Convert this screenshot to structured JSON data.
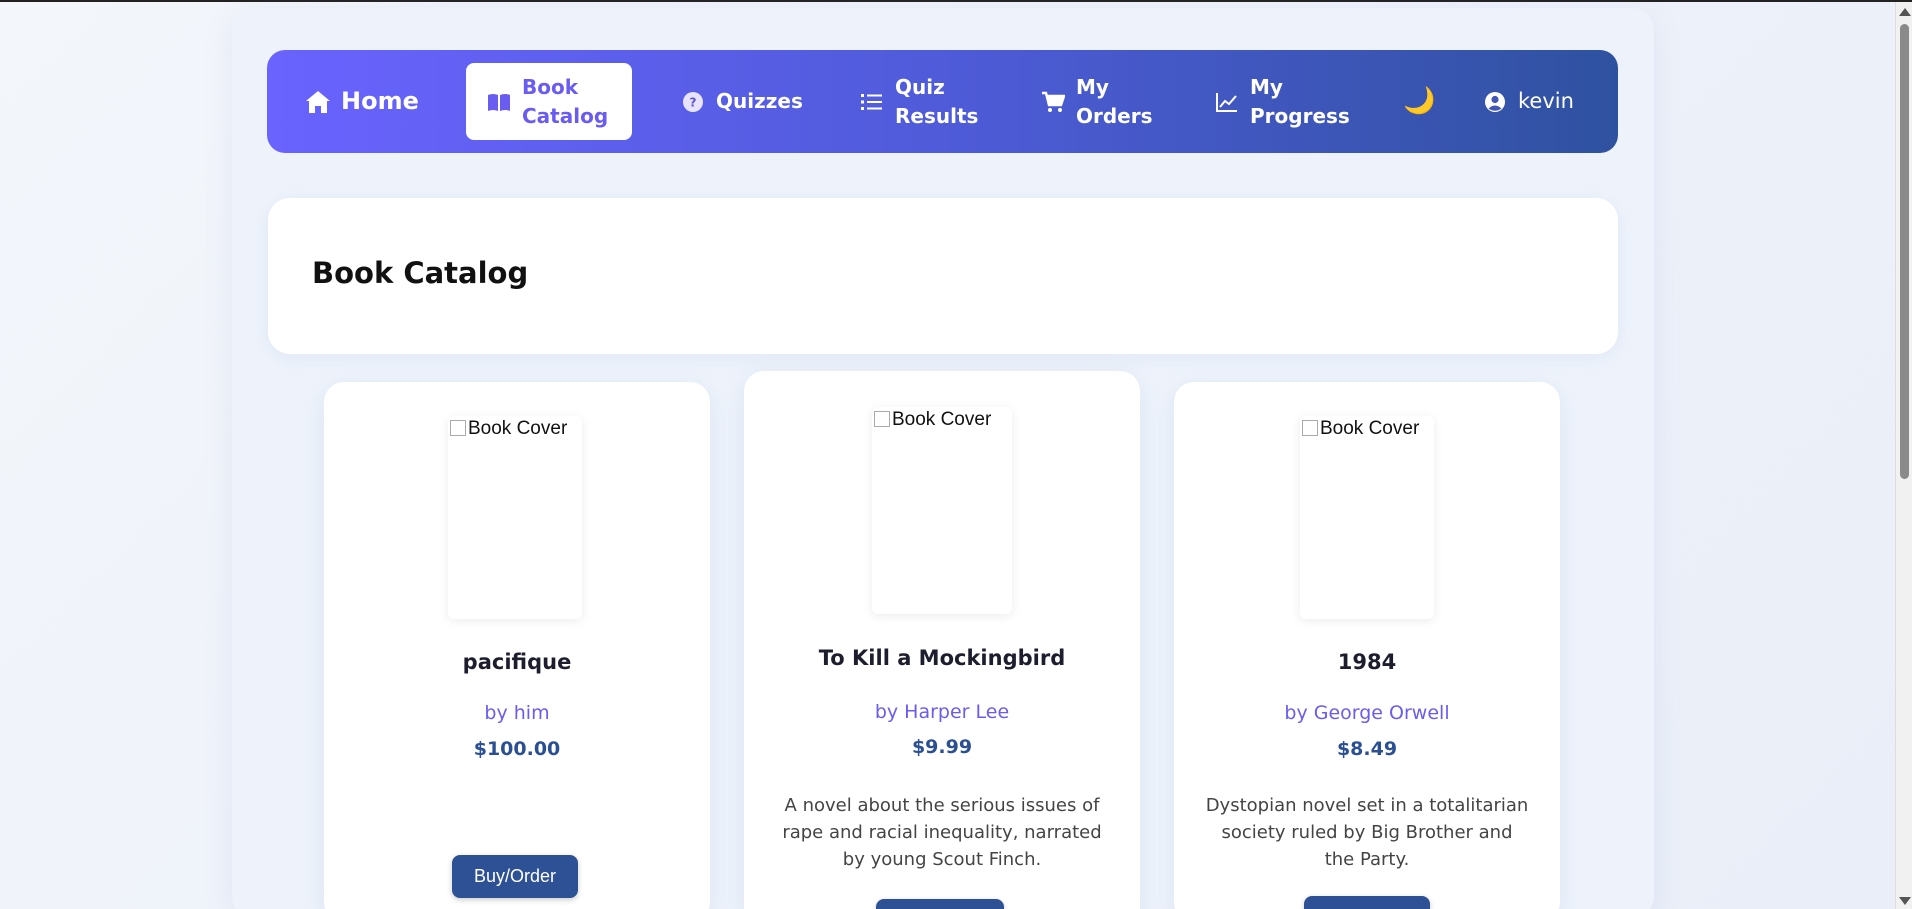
{
  "nav": {
    "home": "Home",
    "catalog_line1": "Book",
    "catalog_line2": "Catalog",
    "quizzes": "Quizzes",
    "results_line1": "Quiz",
    "results_line2": "Results",
    "orders_line1": "My",
    "orders_line2": "Orders",
    "progress_line1": "My",
    "progress_line2": "Progress",
    "moon": "🌙",
    "user": "kevin"
  },
  "page": {
    "title": "Book Catalog"
  },
  "books": [
    {
      "cover_alt": "Book Cover",
      "title": "pacifique",
      "author": "by him",
      "price": "$100.00",
      "description": "",
      "button": "Buy/Order"
    },
    {
      "cover_alt": "Book Cover",
      "title": "To Kill a Mockingbird",
      "author": "by Harper Lee",
      "price": "$9.99",
      "description": "A novel about the serious issues of rape and racial inequality, narrated by young Scout Finch.",
      "button": ""
    },
    {
      "cover_alt": "Book Cover",
      "title": "1984",
      "author": "by George Orwell",
      "price": "$8.49",
      "description": "Dystopian novel set in a totalitarian society ruled by Big Brother and the Party.",
      "button": ""
    }
  ],
  "colors": {
    "accent": "#6a5cf0",
    "price": "#2b4f93",
    "button": "#2e5195"
  }
}
